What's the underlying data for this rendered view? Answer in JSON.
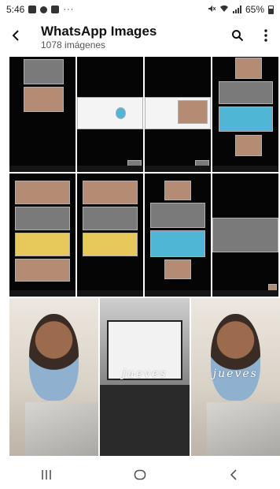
{
  "status_bar": {
    "time": "5:46",
    "notification_dots": "···",
    "battery_text": "65%",
    "battery_level": 0.65
  },
  "app_bar": {
    "title": "WhatsApp Images",
    "subtitle": "1078 imágenes",
    "back_icon": "back-arrow-icon",
    "search_icon": "search-icon",
    "more_icon": "more-vert-icon"
  },
  "gallery": {
    "overlay_text": "jueves"
  },
  "nav": {
    "recents_icon": "recents-icon",
    "home_icon": "home-icon",
    "back_icon": "back-chevron-icon"
  }
}
